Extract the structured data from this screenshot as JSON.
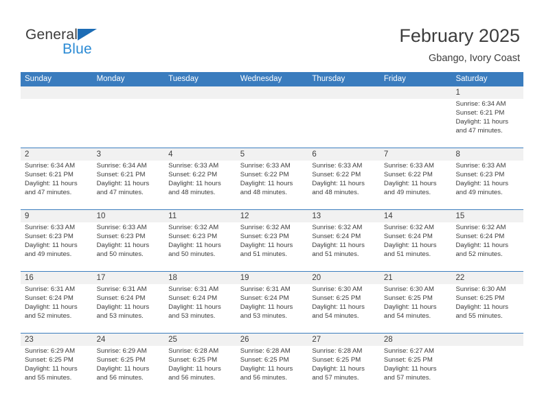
{
  "brand": {
    "name_part1": "General",
    "name_part2": "Blue",
    "triangle_color": "#1c6cb5",
    "blue_color": "#2a8ad4",
    "dark_color": "#3b3b3b"
  },
  "header": {
    "title": "February 2025",
    "subtitle": "Gbango, Ivory Coast"
  },
  "theme": {
    "header_blue": "#3a7cbe",
    "row_band_gray": "#f1f1f1",
    "text_color": "#3c3c3c"
  },
  "weekdays": [
    "Sunday",
    "Monday",
    "Tuesday",
    "Wednesday",
    "Thursday",
    "Friday",
    "Saturday"
  ],
  "weeks": [
    [
      {
        "day": ""
      },
      {
        "day": ""
      },
      {
        "day": ""
      },
      {
        "day": ""
      },
      {
        "day": ""
      },
      {
        "day": ""
      },
      {
        "day": "1",
        "sunrise": "Sunrise: 6:34 AM",
        "sunset": "Sunset: 6:21 PM",
        "daylight": "Daylight: 11 hours and 47 minutes."
      }
    ],
    [
      {
        "day": "2",
        "sunrise": "Sunrise: 6:34 AM",
        "sunset": "Sunset: 6:21 PM",
        "daylight": "Daylight: 11 hours and 47 minutes."
      },
      {
        "day": "3",
        "sunrise": "Sunrise: 6:34 AM",
        "sunset": "Sunset: 6:21 PM",
        "daylight": "Daylight: 11 hours and 47 minutes."
      },
      {
        "day": "4",
        "sunrise": "Sunrise: 6:33 AM",
        "sunset": "Sunset: 6:22 PM",
        "daylight": "Daylight: 11 hours and 48 minutes."
      },
      {
        "day": "5",
        "sunrise": "Sunrise: 6:33 AM",
        "sunset": "Sunset: 6:22 PM",
        "daylight": "Daylight: 11 hours and 48 minutes."
      },
      {
        "day": "6",
        "sunrise": "Sunrise: 6:33 AM",
        "sunset": "Sunset: 6:22 PM",
        "daylight": "Daylight: 11 hours and 48 minutes."
      },
      {
        "day": "7",
        "sunrise": "Sunrise: 6:33 AM",
        "sunset": "Sunset: 6:22 PM",
        "daylight": "Daylight: 11 hours and 49 minutes."
      },
      {
        "day": "8",
        "sunrise": "Sunrise: 6:33 AM",
        "sunset": "Sunset: 6:23 PM",
        "daylight": "Daylight: 11 hours and 49 minutes."
      }
    ],
    [
      {
        "day": "9",
        "sunrise": "Sunrise: 6:33 AM",
        "sunset": "Sunset: 6:23 PM",
        "daylight": "Daylight: 11 hours and 49 minutes."
      },
      {
        "day": "10",
        "sunrise": "Sunrise: 6:33 AM",
        "sunset": "Sunset: 6:23 PM",
        "daylight": "Daylight: 11 hours and 50 minutes."
      },
      {
        "day": "11",
        "sunrise": "Sunrise: 6:32 AM",
        "sunset": "Sunset: 6:23 PM",
        "daylight": "Daylight: 11 hours and 50 minutes."
      },
      {
        "day": "12",
        "sunrise": "Sunrise: 6:32 AM",
        "sunset": "Sunset: 6:23 PM",
        "daylight": "Daylight: 11 hours and 51 minutes."
      },
      {
        "day": "13",
        "sunrise": "Sunrise: 6:32 AM",
        "sunset": "Sunset: 6:24 PM",
        "daylight": "Daylight: 11 hours and 51 minutes."
      },
      {
        "day": "14",
        "sunrise": "Sunrise: 6:32 AM",
        "sunset": "Sunset: 6:24 PM",
        "daylight": "Daylight: 11 hours and 51 minutes."
      },
      {
        "day": "15",
        "sunrise": "Sunrise: 6:32 AM",
        "sunset": "Sunset: 6:24 PM",
        "daylight": "Daylight: 11 hours and 52 minutes."
      }
    ],
    [
      {
        "day": "16",
        "sunrise": "Sunrise: 6:31 AM",
        "sunset": "Sunset: 6:24 PM",
        "daylight": "Daylight: 11 hours and 52 minutes."
      },
      {
        "day": "17",
        "sunrise": "Sunrise: 6:31 AM",
        "sunset": "Sunset: 6:24 PM",
        "daylight": "Daylight: 11 hours and 53 minutes."
      },
      {
        "day": "18",
        "sunrise": "Sunrise: 6:31 AM",
        "sunset": "Sunset: 6:24 PM",
        "daylight": "Daylight: 11 hours and 53 minutes."
      },
      {
        "day": "19",
        "sunrise": "Sunrise: 6:31 AM",
        "sunset": "Sunset: 6:24 PM",
        "daylight": "Daylight: 11 hours and 53 minutes."
      },
      {
        "day": "20",
        "sunrise": "Sunrise: 6:30 AM",
        "sunset": "Sunset: 6:25 PM",
        "daylight": "Daylight: 11 hours and 54 minutes."
      },
      {
        "day": "21",
        "sunrise": "Sunrise: 6:30 AM",
        "sunset": "Sunset: 6:25 PM",
        "daylight": "Daylight: 11 hours and 54 minutes."
      },
      {
        "day": "22",
        "sunrise": "Sunrise: 6:30 AM",
        "sunset": "Sunset: 6:25 PM",
        "daylight": "Daylight: 11 hours and 55 minutes."
      }
    ],
    [
      {
        "day": "23",
        "sunrise": "Sunrise: 6:29 AM",
        "sunset": "Sunset: 6:25 PM",
        "daylight": "Daylight: 11 hours and 55 minutes."
      },
      {
        "day": "24",
        "sunrise": "Sunrise: 6:29 AM",
        "sunset": "Sunset: 6:25 PM",
        "daylight": "Daylight: 11 hours and 56 minutes."
      },
      {
        "day": "25",
        "sunrise": "Sunrise: 6:28 AM",
        "sunset": "Sunset: 6:25 PM",
        "daylight": "Daylight: 11 hours and 56 minutes."
      },
      {
        "day": "26",
        "sunrise": "Sunrise: 6:28 AM",
        "sunset": "Sunset: 6:25 PM",
        "daylight": "Daylight: 11 hours and 56 minutes."
      },
      {
        "day": "27",
        "sunrise": "Sunrise: 6:28 AM",
        "sunset": "Sunset: 6:25 PM",
        "daylight": "Daylight: 11 hours and 57 minutes."
      },
      {
        "day": "28",
        "sunrise": "Sunrise: 6:27 AM",
        "sunset": "Sunset: 6:25 PM",
        "daylight": "Daylight: 11 hours and 57 minutes."
      },
      {
        "day": ""
      }
    ]
  ]
}
